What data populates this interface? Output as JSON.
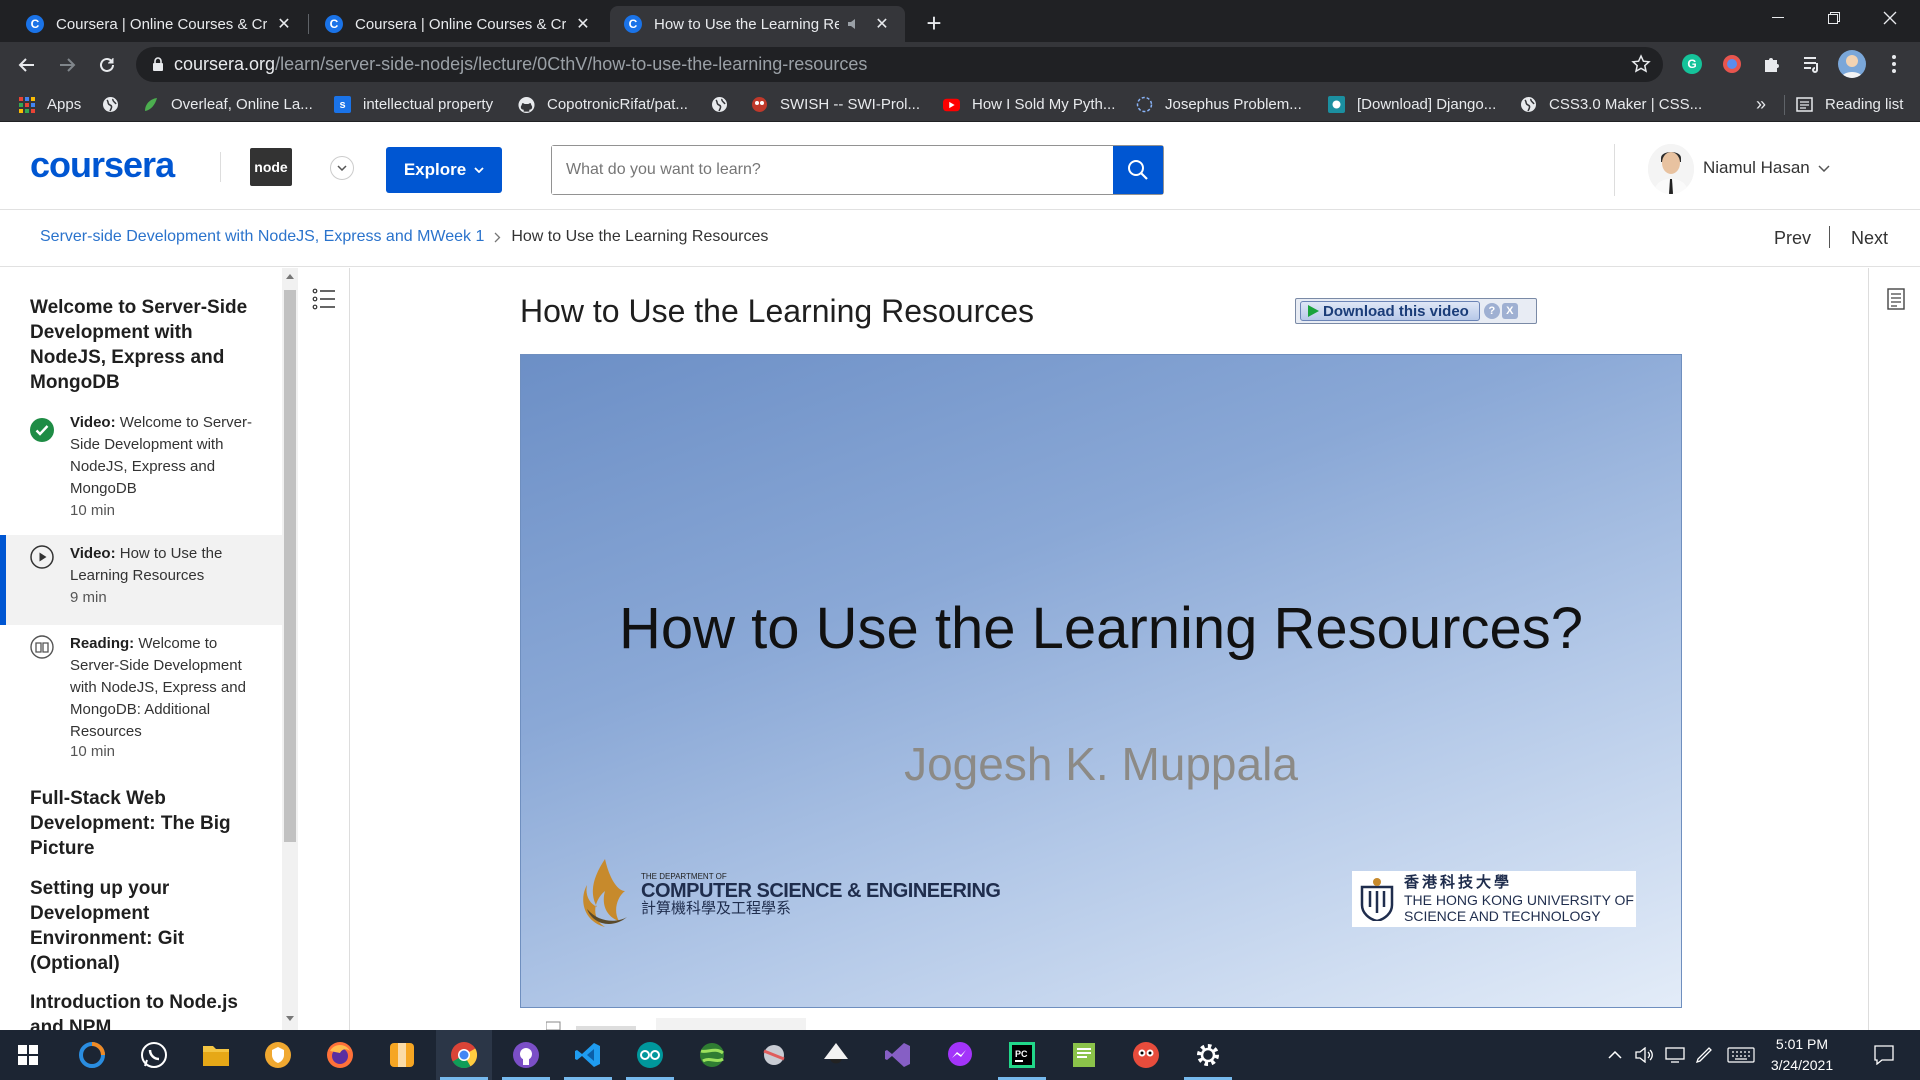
{
  "browser": {
    "tabs": [
      {
        "title": "Coursera | Online Courses & Credentials From Top Educators"
      },
      {
        "title": "Coursera | Online Courses & Credentials From Top Educators"
      },
      {
        "title": "How to Use the Learning Resources"
      }
    ],
    "url_host": "coursera.org",
    "url_path": "/learn/server-side-nodejs/lecture/0CthV/how-to-use-the-learning-resources",
    "bookmarks": [
      {
        "label": "Apps"
      },
      {
        "label": "Overleaf, Online La..."
      },
      {
        "label": "intellectual property"
      },
      {
        "label": "CopotronicRifat/pat..."
      },
      {
        "label": "SWISH -- SWI-Prol..."
      },
      {
        "label": "How I Sold My Pyth..."
      },
      {
        "label": "Josephus Problem..."
      },
      {
        "label": "[Download] Django..."
      },
      {
        "label": "CSS3.0 Maker | CSS..."
      }
    ],
    "reading_list": "Reading list",
    "more_bookmarks": "»"
  },
  "header": {
    "logo": "coursera",
    "partner_logo": "node",
    "explore_label": "Explore",
    "search_placeholder": "What do you want to learn?",
    "user_name": "Niamul Hasan"
  },
  "breadcrumb": {
    "course": "Server-side Development with NodeJS, Express and MWeek 1",
    "current": "How to Use the Learning Resources",
    "prev": "Prev",
    "next": "Next"
  },
  "sidebar": {
    "sections": [
      {
        "title": "Welcome to Server-Side Development with NodeJS, Express and MongoDB"
      },
      {
        "title": "Full-Stack Web Development: The Big Picture"
      },
      {
        "title": "Setting up your Development Environment: Git (Optional)"
      },
      {
        "title": "Introduction to Node.js and NPM"
      }
    ],
    "items": [
      {
        "type": "Video:",
        "title": "Welcome to Server-Side Development with NodeJS, Express and MongoDB",
        "duration": "10 min",
        "status": "completed"
      },
      {
        "type": "Video:",
        "title": "How to Use the Learning Resources",
        "duration": "9 min",
        "status": "current"
      },
      {
        "type": "Reading:",
        "title": "Welcome to Server-Side Development with NodeJS, Express and MongoDB: Additional Resources",
        "duration": "10 min",
        "status": "not-started"
      }
    ]
  },
  "main": {
    "title": "How to Use the Learning Resources",
    "download": {
      "label": "Download this video",
      "help": "?",
      "close": "X"
    }
  },
  "video_slide": {
    "title": "How to Use the Learning Resources?",
    "presenter": "Jogesh K. Muppala",
    "dept_small": "THE DEPARTMENT OF",
    "dept_name": "COMPUTER SCIENCE & ENGINEERING",
    "dept_cn": "計算機科學及工程學系",
    "uni_cn": "香港科技大學",
    "uni_en_1": "THE HONG KONG UNIVERSITY OF",
    "uni_en_2": "SCIENCE AND TECHNOLOGY"
  },
  "taskbar": {
    "time": "5:01 PM",
    "date": "3/24/2021"
  },
  "colors": {
    "brand": "#0056d2",
    "completed": "#1e8c45",
    "chrome_dark": "#202124",
    "chrome_toolbar": "#35363a",
    "taskbar": "#1c2533"
  }
}
